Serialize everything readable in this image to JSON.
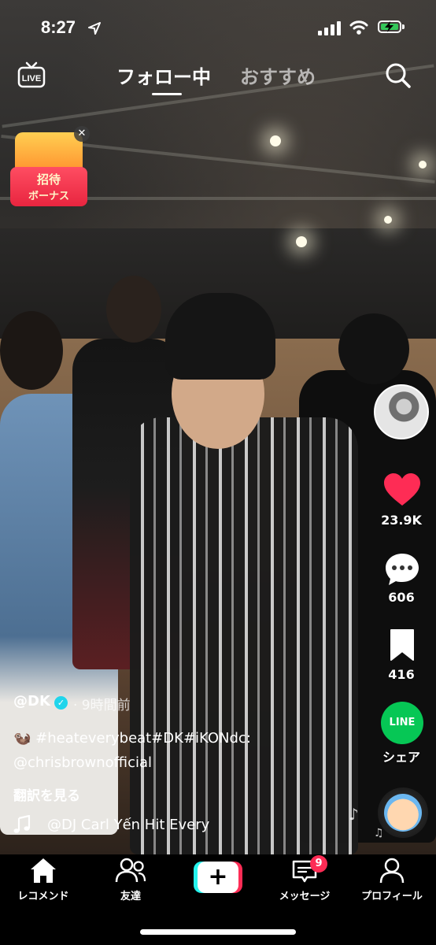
{
  "status_bar": {
    "time": "8:27"
  },
  "top_nav": {
    "live_label": "LIVE",
    "tab_following": "フォロー中",
    "tab_for_you": "おすすめ"
  },
  "invite_badge": {
    "line1": "招待",
    "line2": "ボーナス"
  },
  "right_rail": {
    "likes": "23.9K",
    "comments": "606",
    "saves": "416",
    "share_label": "シェア",
    "line_text": "LINE"
  },
  "caption": {
    "author": "@DK",
    "time_ago": "· 9時間前",
    "text_line1": "🦦 #heateverybeat#DK#iKONdc:",
    "text_line2": "@chrisbrownofficial",
    "translate": "翻訳を見る",
    "sound": "@DJ Carl Yến    Hit Every"
  },
  "tab_bar": {
    "home": "レコメンド",
    "friends": "友達",
    "inbox": "メッセージ",
    "inbox_badge": "9",
    "profile": "プロフィール"
  },
  "colors": {
    "like_red": "#fe2c55",
    "line_green": "#06c755",
    "verified_blue": "#20d5ec",
    "create_cyan": "#25f4ee"
  }
}
